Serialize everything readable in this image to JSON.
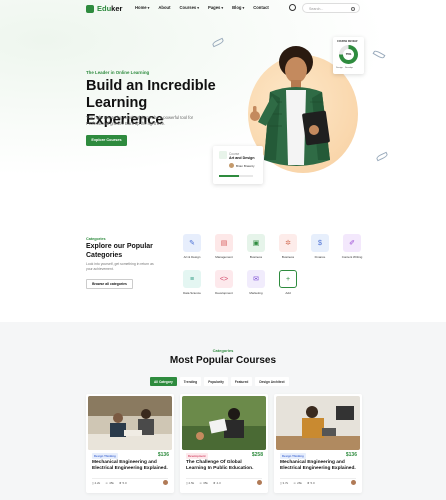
{
  "header": {
    "logo_prefix": "Edu",
    "logo_suffix": "ker",
    "nav": [
      {
        "label": "Home",
        "has_caret": true
      },
      {
        "label": "About",
        "has_caret": false
      },
      {
        "label": "Courses",
        "has_caret": true
      },
      {
        "label": "Pages",
        "has_caret": true
      },
      {
        "label": "Blog",
        "has_caret": true
      },
      {
        "label": "Contact",
        "has_caret": false
      }
    ],
    "search_placeholder": "Search..."
  },
  "hero": {
    "tag": "The Leader in Online Learning",
    "title": "Build an Incredible Learning Experience",
    "description": "The right mentoring relationship can be a powerful tool for Professional growth. Bark up the right tree.",
    "cta": "Explore Courses",
    "stat_card": {
      "title": "COURSE REVIEW",
      "percent": "75%",
      "legend": [
        "Design",
        "Develop"
      ]
    },
    "course_card": {
      "subtitle": "Course",
      "title": "Art and Design",
      "author": "Brian Brawnly"
    }
  },
  "categories": {
    "tag": "Categories",
    "title": "Explore our Popular Categories",
    "description": "Look into yourself, get something in return as your achievement.",
    "button": "Browse all categories",
    "items": [
      {
        "label": "Art & Design",
        "icon": "palette-icon",
        "bg": "#e7eefc",
        "fg": "#4a6fd4",
        "glyph": "✎"
      },
      {
        "label": "Management",
        "icon": "chart-icon",
        "bg": "#fde8e8",
        "fg": "#d45858",
        "glyph": "▤"
      },
      {
        "label": "Business",
        "icon": "briefcase-icon",
        "bg": "#e6f4ea",
        "fg": "#2e8b3e",
        "glyph": "▣"
      },
      {
        "label": "Business",
        "icon": "gears-icon",
        "bg": "#fdecea",
        "fg": "#d4725a",
        "glyph": "✲"
      },
      {
        "label": "Finance",
        "icon": "dollar-icon",
        "bg": "#e7effc",
        "fg": "#4a6fd4",
        "glyph": "$"
      },
      {
        "label": "Content Writing",
        "icon": "pen-icon",
        "bg": "#f3e8fc",
        "fg": "#9a4ad4",
        "glyph": "✐"
      },
      {
        "label": "Data Science",
        "icon": "database-icon",
        "bg": "#e4f6f2",
        "fg": "#2e9b82",
        "glyph": "≡"
      },
      {
        "label": "Development",
        "icon": "code-icon",
        "bg": "#fde9ec",
        "fg": "#d44a6a",
        "glyph": "<>"
      },
      {
        "label": "Marketing",
        "icon": "megaphone-icon",
        "bg": "#f1ecfc",
        "fg": "#7a4ad4",
        "glyph": "✉"
      },
      {
        "label": "Add",
        "icon": "plus-icon",
        "bg": "#ffffff",
        "fg": "#2e8b3e",
        "glyph": "+"
      }
    ]
  },
  "popular": {
    "tag": "Categories",
    "title": "Most Popular Courses",
    "filters": [
      "All Category",
      "Trending",
      "Popularity",
      "Featured",
      "Design Architect"
    ],
    "courses": [
      {
        "badge": "Design Thinking",
        "badge_bg": "#e7eefc",
        "badge_fg": "#4a6fd4",
        "price": "$136",
        "title": "Mechanical Engineering and Electrical Engineering Explained.",
        "lessons": "4.2k",
        "students": "45k",
        "rating": "5.0"
      },
      {
        "badge": "Development",
        "badge_bg": "#fde9ec",
        "badge_fg": "#d44a6a",
        "price": "$258",
        "title": "The Challenge Of Global Learning In Public Education.",
        "lessons": "2.5k",
        "students": "35k",
        "rating": "4.3"
      },
      {
        "badge": "Design Thinking",
        "badge_bg": "#e7eefc",
        "badge_fg": "#4a6fd4",
        "price": "$136",
        "title": "Mechanical Engineering and Electrical Engineering Explained.",
        "lessons": "3.7k",
        "students": "26k",
        "rating": "5.0"
      }
    ]
  }
}
